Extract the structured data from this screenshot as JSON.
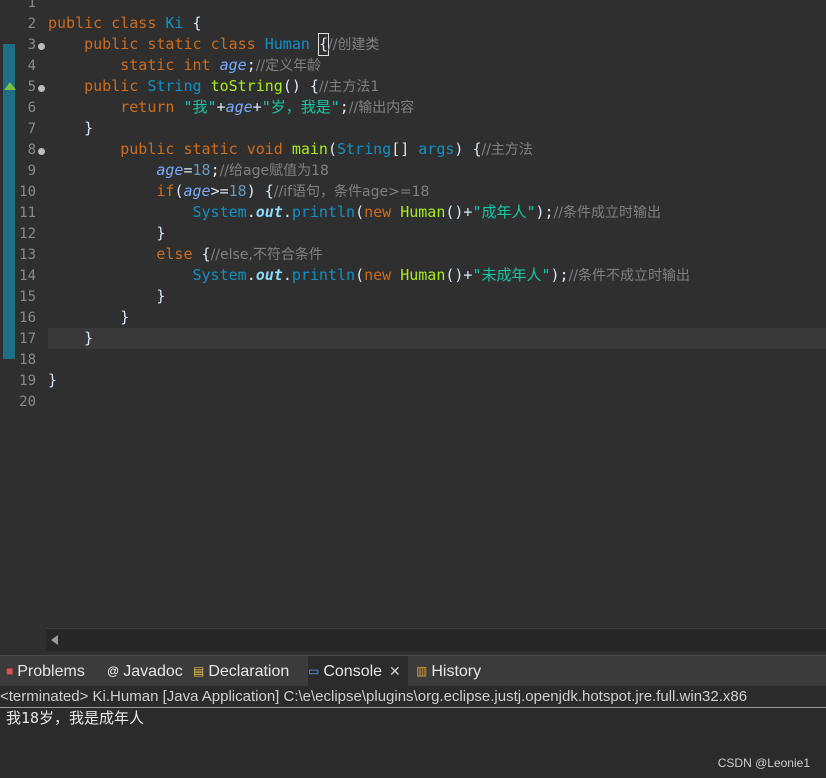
{
  "editor": {
    "line_numbers": [
      "1",
      "2",
      "3",
      "4",
      "5",
      "6",
      "7",
      "8",
      "9",
      "10",
      "11",
      "12",
      "13",
      "14",
      "15",
      "16",
      "17",
      "18",
      "19",
      "20"
    ],
    "lines": [
      {
        "tokens": []
      },
      {
        "tokens": [
          {
            "c": "kw",
            "t": "public"
          },
          {
            "c": "pl",
            "t": " "
          },
          {
            "c": "kw",
            "t": "class"
          },
          {
            "c": "pl",
            "t": " "
          },
          {
            "c": "ty",
            "t": "Ki"
          },
          {
            "c": "pl",
            "t": " {"
          }
        ]
      },
      {
        "tokens": [
          {
            "c": "pl",
            "t": "    "
          },
          {
            "c": "kw",
            "t": "public"
          },
          {
            "c": "pl",
            "t": " "
          },
          {
            "c": "kw",
            "t": "static"
          },
          {
            "c": "pl",
            "t": " "
          },
          {
            "c": "kw",
            "t": "class"
          },
          {
            "c": "pl",
            "t": " "
          },
          {
            "c": "ty",
            "t": "Human"
          },
          {
            "c": "pl",
            "t": " "
          },
          {
            "c": "cur",
            "t": "{"
          },
          {
            "c": "cm",
            "t": "//创建类"
          }
        ]
      },
      {
        "tokens": [
          {
            "c": "pl",
            "t": "        "
          },
          {
            "c": "kw",
            "t": "static"
          },
          {
            "c": "pl",
            "t": " "
          },
          {
            "c": "kw",
            "t": "int"
          },
          {
            "c": "pl",
            "t": " "
          },
          {
            "c": "vi",
            "t": "age"
          },
          {
            "c": "pl",
            "t": ";"
          },
          {
            "c": "cm",
            "t": "//定义年龄"
          }
        ]
      },
      {
        "tokens": [
          {
            "c": "pl",
            "t": "    "
          },
          {
            "c": "kw",
            "t": "public"
          },
          {
            "c": "pl",
            "t": " "
          },
          {
            "c": "ty",
            "t": "String"
          },
          {
            "c": "pl",
            "t": " "
          },
          {
            "c": "fn",
            "t": "toString"
          },
          {
            "c": "pl",
            "t": "() {"
          },
          {
            "c": "cm",
            "t": "//主方法1"
          }
        ]
      },
      {
        "tokens": [
          {
            "c": "pl",
            "t": "        "
          },
          {
            "c": "kw",
            "t": "return"
          },
          {
            "c": "pl",
            "t": " "
          },
          {
            "c": "st",
            "t": "\"我\""
          },
          {
            "c": "pl",
            "t": "+"
          },
          {
            "c": "vi",
            "t": "age"
          },
          {
            "c": "pl",
            "t": "+"
          },
          {
            "c": "st",
            "t": "\"岁，我是\""
          },
          {
            "c": "pl",
            "t": ";"
          },
          {
            "c": "cm",
            "t": "//输出内容"
          }
        ]
      },
      {
        "tokens": [
          {
            "c": "pl",
            "t": "    }"
          }
        ]
      },
      {
        "tokens": [
          {
            "c": "pl",
            "t": "        "
          },
          {
            "c": "kw",
            "t": "public"
          },
          {
            "c": "pl",
            "t": " "
          },
          {
            "c": "kw",
            "t": "static"
          },
          {
            "c": "pl",
            "t": " "
          },
          {
            "c": "kw",
            "t": "void"
          },
          {
            "c": "pl",
            "t": " "
          },
          {
            "c": "fn",
            "t": "main"
          },
          {
            "c": "pl",
            "t": "("
          },
          {
            "c": "ty",
            "t": "String"
          },
          {
            "c": "pl",
            "t": "[] "
          },
          {
            "c": "ty",
            "t": "args"
          },
          {
            "c": "pl",
            "t": ") {"
          },
          {
            "c": "cm",
            "t": "//主方法"
          }
        ]
      },
      {
        "tokens": [
          {
            "c": "pl",
            "t": "            "
          },
          {
            "c": "vi",
            "t": "age"
          },
          {
            "c": "pl",
            "t": "="
          },
          {
            "c": "nu",
            "t": "18"
          },
          {
            "c": "pl",
            "t": ";"
          },
          {
            "c": "cm",
            "t": "//给age赋值为18"
          }
        ]
      },
      {
        "tokens": [
          {
            "c": "pl",
            "t": "            "
          },
          {
            "c": "kw",
            "t": "if"
          },
          {
            "c": "pl",
            "t": "("
          },
          {
            "c": "vi",
            "t": "age"
          },
          {
            "c": "pl",
            "t": ">="
          },
          {
            "c": "nu",
            "t": "18"
          },
          {
            "c": "pl",
            "t": ") {"
          },
          {
            "c": "cm",
            "t": "//if语句，条件age>=18"
          }
        ]
      },
      {
        "tokens": [
          {
            "c": "pl",
            "t": "                "
          },
          {
            "c": "ty",
            "t": "System"
          },
          {
            "c": "pl",
            "t": "."
          },
          {
            "c": "so",
            "t": "out"
          },
          {
            "c": "pl",
            "t": "."
          },
          {
            "c": "ty",
            "t": "println"
          },
          {
            "c": "pl",
            "t": "("
          },
          {
            "c": "kw",
            "t": "new"
          },
          {
            "c": "pl",
            "t": " "
          },
          {
            "c": "fn",
            "t": "Human"
          },
          {
            "c": "pl",
            "t": "()+"
          },
          {
            "c": "st",
            "t": "\"成年人\""
          },
          {
            "c": "pl",
            "t": ");"
          },
          {
            "c": "cm",
            "t": "//条件成立时输出"
          }
        ]
      },
      {
        "tokens": [
          {
            "c": "pl",
            "t": "            }"
          }
        ]
      },
      {
        "tokens": [
          {
            "c": "pl",
            "t": "            "
          },
          {
            "c": "kw",
            "t": "else"
          },
          {
            "c": "pl",
            "t": " {"
          },
          {
            "c": "cm",
            "t": "//else,不符合条件"
          }
        ]
      },
      {
        "tokens": [
          {
            "c": "pl",
            "t": "                "
          },
          {
            "c": "ty",
            "t": "System"
          },
          {
            "c": "pl",
            "t": "."
          },
          {
            "c": "so",
            "t": "out"
          },
          {
            "c": "pl",
            "t": "."
          },
          {
            "c": "ty",
            "t": "println"
          },
          {
            "c": "pl",
            "t": "("
          },
          {
            "c": "kw",
            "t": "new"
          },
          {
            "c": "pl",
            "t": " "
          },
          {
            "c": "fn",
            "t": "Human"
          },
          {
            "c": "pl",
            "t": "()+"
          },
          {
            "c": "st",
            "t": "\"未成年人\""
          },
          {
            "c": "pl",
            "t": ");"
          },
          {
            "c": "cm",
            "t": "//条件不成立时输出"
          }
        ]
      },
      {
        "tokens": [
          {
            "c": "pl",
            "t": "            }"
          }
        ]
      },
      {
        "tokens": [
          {
            "c": "pl",
            "t": "        }"
          }
        ]
      },
      {
        "tokens": [
          {
            "c": "pl",
            "t": "    }"
          }
        ],
        "current": true
      },
      {
        "tokens": []
      },
      {
        "tokens": [
          {
            "c": "pl",
            "t": "}"
          }
        ]
      },
      {
        "tokens": []
      }
    ],
    "fold_markers_on_lines": [
      3,
      5,
      8
    ],
    "override_marker_on_line": 5,
    "quick_diff_ranges": [
      [
        3,
        17
      ]
    ]
  },
  "panel": {
    "tabs": [
      {
        "label": "Problems",
        "icon": "problems-icon",
        "glyph": "■"
      },
      {
        "label": "Javadoc",
        "icon": "javadoc-icon",
        "glyph": "@"
      },
      {
        "label": "Declaration",
        "icon": "declaration-icon",
        "glyph": "▤"
      },
      {
        "label": "Console",
        "icon": "console-icon",
        "glyph": "▭",
        "active": true,
        "closable": true
      },
      {
        "label": "History",
        "icon": "history-icon",
        "glyph": "▥"
      }
    ],
    "close_glyph": "✕",
    "terminated_line": "<terminated> Ki.Human [Java Application] C:\\e\\eclipse\\plugins\\org.eclipse.justj.openjdk.hotspot.jre.full.win32.x86",
    "output": "我18岁，我是成年人"
  },
  "watermark": "CSDN @Leonie1",
  "colors": {
    "editor_bg": "#2f2f2f",
    "keyword": "#cc6c1d",
    "type": "#1290c3",
    "method": "#a7ec21",
    "static_field": "#79abff",
    "comment": "#808080",
    "string": "#17c6a3",
    "number": "#6897bb"
  }
}
